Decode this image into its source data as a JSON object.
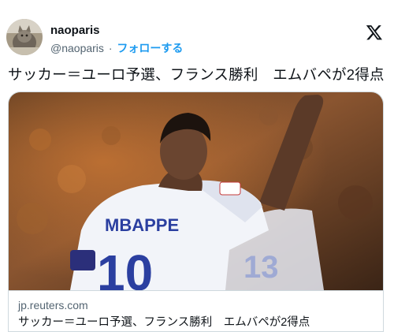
{
  "author": {
    "display_name": "naoparis",
    "handle": "@naoparis",
    "separator": "·",
    "follow_label": "フォローする"
  },
  "tweet": {
    "text": "サッカー＝ユーロ予選、フランス勝利　エムバペが2得点"
  },
  "card": {
    "domain": "jp.reuters.com",
    "title": "サッカー＝ユーロ予選、フランス勝利　エムバペが2得点",
    "jersey_name": "MBAPPE",
    "jersey_number": "10",
    "back_number": "13"
  },
  "icons": {
    "brand": "x-logo-icon",
    "avatar": "profile-avatar"
  },
  "colors": {
    "accent": "#1d9bf0",
    "text_primary": "#0f1419",
    "text_secondary": "#536471",
    "border": "#cfd9de"
  }
}
